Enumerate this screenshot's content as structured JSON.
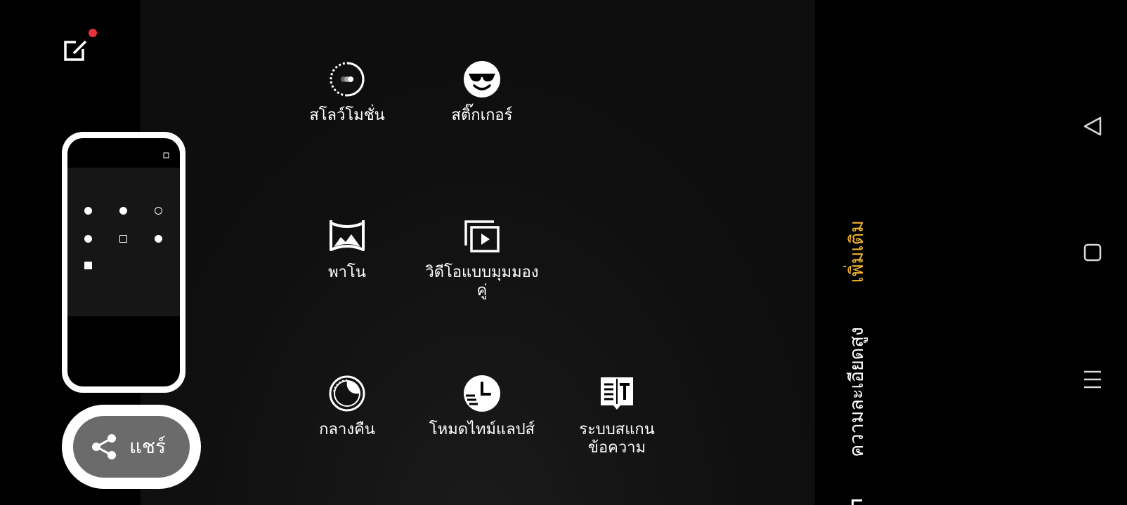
{
  "modes": [
    {
      "label": "สโลว์โมชั่น",
      "icon": "slow-motion-icon"
    },
    {
      "label": "สติ๊กเกอร์",
      "icon": "sticker-icon"
    },
    {
      "label": "พาโน",
      "icon": "panorama-icon"
    },
    {
      "label": "วิดีโอแบบมุมมองคู่",
      "icon": "dual-view-video-icon"
    },
    {
      "label": "กลางคืน",
      "icon": "night-icon"
    },
    {
      "label": "โหมดไทม์แลปส์",
      "icon": "time-lapse-icon"
    },
    {
      "label": "ระบบสแกนข้อความ",
      "icon": "text-scanner-icon"
    }
  ],
  "share": {
    "label": "แชร์",
    "icon": "share-icon"
  },
  "tabs": {
    "more": "เพิ่มเติม",
    "high_resolution": "ความละเอียดสูง"
  },
  "thumbnail": {
    "tab_left": "ความละเอียดสูง",
    "tab_active": "เพิ่มเติม"
  },
  "colors": {
    "accent": "#f5b82e",
    "background": "#000000",
    "panel": "#141414",
    "notification_dot": "#e8333b",
    "share_button": "#6b6b6b"
  },
  "icons": {
    "edit": "edit-icon",
    "nav_back": "back-triangle-icon",
    "nav_home": "home-square-icon",
    "nav_recents": "recents-menu-icon"
  }
}
